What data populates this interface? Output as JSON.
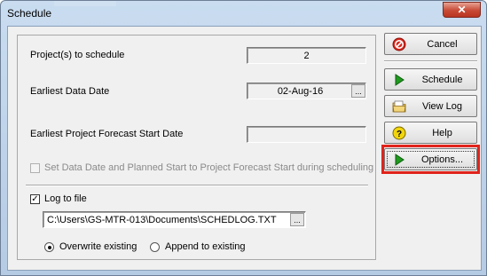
{
  "window": {
    "title": "Schedule",
    "close_glyph": "✕"
  },
  "schedule": {
    "projects_label": "Project(s) to schedule",
    "projects_value": "2",
    "data_date_label": "Earliest Data Date",
    "data_date_value": "02-Aug-16",
    "forecast_label": "Earliest Project Forecast Start Date",
    "forecast_value": "",
    "ellipsis": "...",
    "set_data_date_label": "Set Data Date and Planned Start to Project Forecast Start during scheduling",
    "set_data_date_checked": false
  },
  "log": {
    "log_to_file_label": "Log to file",
    "log_to_file_checked": true,
    "path_value": "C:\\Users\\GS-MTR-013\\Documents\\SCHEDLOG.TXT",
    "overwrite_label": "Overwrite existing",
    "append_label": "Append to existing",
    "selected_mode": "overwrite"
  },
  "buttons": {
    "cancel": "Cancel",
    "schedule": "Schedule",
    "view_log": "View Log",
    "help": "Help",
    "options": "Options..."
  },
  "icons": {
    "cancel": "no-entry-icon",
    "schedule": "play-arrow-icon",
    "view_log": "folder-icon",
    "help": "question-icon",
    "options": "play-arrow-icon"
  },
  "colors": {
    "highlight": "#e0241b",
    "cancel_icon": "#d9261c",
    "arrow_icon": "#1f9a1f",
    "help_icon": "#f2d60c"
  }
}
